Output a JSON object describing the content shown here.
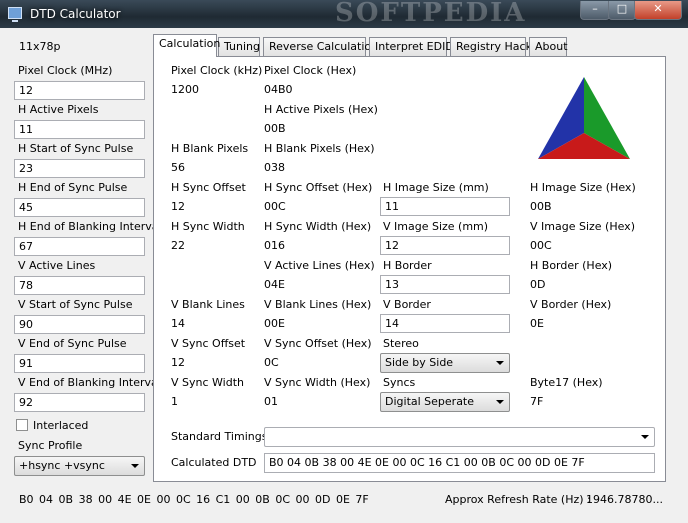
{
  "window": {
    "title": "DTD Calculator",
    "watermark": "SOFTPEDIA",
    "minimize": "–",
    "maximize": "□",
    "close": "✕"
  },
  "left": {
    "resolution": "11x78p",
    "fields": [
      {
        "label": "Pixel Clock (MHz)",
        "value": "12"
      },
      {
        "label": "H Active Pixels",
        "value": "11"
      },
      {
        "label": "H Start of Sync Pulse",
        "value": "23"
      },
      {
        "label": "H End of Sync Pulse",
        "value": "45"
      },
      {
        "label": "H End of Blanking Interval",
        "value": "67"
      },
      {
        "label": "V Active Lines",
        "value": "78"
      },
      {
        "label": "V Start of Sync Pulse",
        "value": "90"
      },
      {
        "label": "V End of Sync Pulse",
        "value": "91"
      },
      {
        "label": "V End of Blanking Interval",
        "value": "92"
      }
    ],
    "interlaced_label": "Interlaced",
    "interlaced_checked": false,
    "sync_profile_label": "Sync Profile",
    "sync_profile_value": "+hsync +vsync"
  },
  "tabs": [
    "Calculation",
    "Tuning",
    "Reverse Calculation",
    "Interpret EDID",
    "Registry Hack",
    "About"
  ],
  "active_tab": "Calculation",
  "calc": {
    "col1": [
      {
        "label": "Pixel Clock (kHz)",
        "value": "1200"
      },
      {
        "label": "H Blank Pixels",
        "value": "56"
      },
      {
        "label": "H Sync Offset",
        "value": "12"
      },
      {
        "label": "H Sync Width",
        "value": "22"
      },
      {
        "label": "V Blank Lines",
        "value": "14"
      },
      {
        "label": "V Sync Offset",
        "value": "12"
      },
      {
        "label": "V Sync Width",
        "value": "1"
      }
    ],
    "col2": [
      {
        "label": "Pixel Clock (Hex)",
        "value": "04B0"
      },
      {
        "label": "H Active Pixels (Hex)",
        "value": "00B"
      },
      {
        "label": "H Blank Pixels (Hex)",
        "value": "038"
      },
      {
        "label": "H Sync Offset (Hex)",
        "value": "00C"
      },
      {
        "label": "H Sync Width (Hex)",
        "value": "016"
      },
      {
        "label": "V Active Lines (Hex)",
        "value": "04E"
      },
      {
        "label": "V Blank Lines (Hex)",
        "value": "00E"
      },
      {
        "label": "V Sync Offset (Hex)",
        "value": "0C"
      },
      {
        "label": "V Sync Width (Hex)",
        "value": "01"
      }
    ],
    "col3": [
      {
        "label": "H Image Size (mm)",
        "value": "11"
      },
      {
        "label": "V Image Size (mm)",
        "value": "12"
      },
      {
        "label": "H Border",
        "value": "13"
      },
      {
        "label": "V Border",
        "value": "14"
      },
      {
        "label": "Stereo",
        "value": "Side by Side"
      },
      {
        "label": "Syncs",
        "value": "Digital Seperate"
      }
    ],
    "col4": [
      {
        "label": "H Image Size (Hex)",
        "value": "00B"
      },
      {
        "label": "V Image Size (Hex)",
        "value": "00C"
      },
      {
        "label": "H Border (Hex)",
        "value": "0D"
      },
      {
        "label": "V Border (Hex)",
        "value": "0E"
      },
      {
        "label": "Byte17 (Hex)",
        "value": "7F"
      }
    ],
    "standard_timings_label": "Standard Timings",
    "standard_timings_value": "",
    "calculated_dtd_label": "Calculated DTD",
    "calculated_dtd_value": "B0 04 0B 38 00 4E 0E 00 0C 16 C1 00 0B 0C 00 0D 0E 7F"
  },
  "logo_colors": {
    "top": "#1a9a2a",
    "left": "#2233a8",
    "bottom": "#c81a1a",
    "right": "#0d8a1e"
  },
  "status": {
    "bytes": "B0  04  0B  38  00  4E  0E  00  0C  16  C1  00  0B  0C  00  0D  0E  7F",
    "refresh_label": "Approx Refresh Rate (Hz) :",
    "refresh_value": "1946.78780..."
  }
}
